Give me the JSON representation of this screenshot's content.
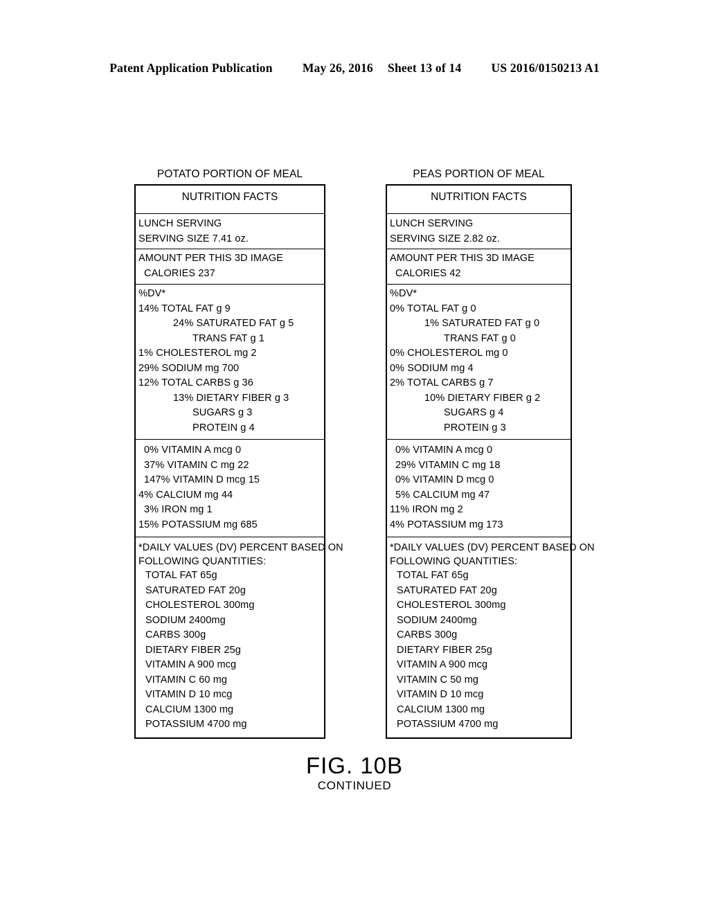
{
  "header": {
    "publication": "Patent Application Publication",
    "date": "May 26, 2016",
    "sheet": "Sheet 13 of 14",
    "docnum": "US 2016/0150213 A1"
  },
  "caption": {
    "label": "FIG. 10B",
    "sublabel": "CONTINUED"
  },
  "panels": [
    {
      "title": "POTATO PORTION OF MEAL",
      "facts_heading": "NUTRITION FACTS",
      "serving": {
        "meal": "LUNCH SERVING",
        "size": "SERVING SIZE 7.41 oz."
      },
      "amount": {
        "per": "AMOUNT PER THIS 3D IMAGE",
        "calories": "CALORIES 237"
      },
      "dv_header": "%DV*",
      "macros": [
        {
          "text": "14% TOTAL FAT g 9",
          "indent": 0
        },
        {
          "text": "24% SATURATED FAT g 5",
          "indent": 1
        },
        {
          "text": "TRANS FAT g 1",
          "indent": 2
        },
        {
          "text": "1% CHOLESTEROL mg 2",
          "indent": 0
        },
        {
          "text": "29% SODIUM mg 700",
          "indent": 0
        },
        {
          "text": "12% TOTAL CARBS g 36",
          "indent": 0
        },
        {
          "text": "13% DIETARY FIBER g 3",
          "indent": 1
        },
        {
          "text": "SUGARS g 3",
          "indent": 2
        },
        {
          "text": "PROTEIN g 4",
          "indent": 2
        }
      ],
      "micros": [
        "0% VITAMIN A mcg 0",
        "37% VITAMIN C mg 22",
        "147% VITAMIN D mcg 15",
        "4% CALCIUM mg 44",
        "3% IRON mg 1",
        "15% POTASSIUM mg 685"
      ],
      "dv_note_line1": "*DAILY VALUES (DV) PERCENT BASED ON",
      "dv_note_line2": "FOLLOWING QUANTITIES:",
      "dv_values": [
        "TOTAL FAT 65g",
        "SATURATED FAT 20g",
        "CHOLESTEROL 300mg",
        "SODIUM 2400mg",
        "CARBS 300g",
        "DIETARY FIBER 25g",
        "VITAMIN A 900 mcg",
        "VITAMIN C 60 mg",
        "VITAMIN D 10 mcg",
        "CALCIUM 1300 mg",
        "POTASSIUM 4700 mg"
      ]
    },
    {
      "title": "PEAS PORTION OF MEAL",
      "facts_heading": "NUTRITION FACTS",
      "serving": {
        "meal": "LUNCH SERVING",
        "size": "SERVING SIZE 2.82 oz."
      },
      "amount": {
        "per": "AMOUNT PER THIS 3D IMAGE",
        "calories": "CALORIES 42"
      },
      "dv_header": "%DV*",
      "macros": [
        {
          "text": "0% TOTAL FAT g 0",
          "indent": 0
        },
        {
          "text": "1% SATURATED FAT g 0",
          "indent": 1
        },
        {
          "text": "TRANS FAT g 0",
          "indent": 2
        },
        {
          "text": "0% CHOLESTEROL mg 0",
          "indent": 0
        },
        {
          "text": "0% SODIUM mg 4",
          "indent": 0
        },
        {
          "text": "2% TOTAL CARBS g 7",
          "indent": 0
        },
        {
          "text": "10% DIETARY FIBER g 2",
          "indent": 1
        },
        {
          "text": "SUGARS g 4",
          "indent": 2
        },
        {
          "text": "PROTEIN g 3",
          "indent": 2
        }
      ],
      "micros": [
        "0% VITAMIN A mcg 0",
        "29% VITAMIN C mg 18",
        "0% VITAMIN D mcg 0",
        "5% CALCIUM mg 47",
        "11% IRON mg 2",
        "4% POTASSIUM mg 173"
      ],
      "dv_note_line1": "*DAILY VALUES (DV) PERCENT BASED ON",
      "dv_note_line2": "FOLLOWING QUANTITIES:",
      "dv_values": [
        "TOTAL FAT 65g",
        "SATURATED FAT 20g",
        "CHOLESTEROL 300mg",
        "SODIUM 2400mg",
        "CARBS 300g",
        "DIETARY FIBER 25g",
        "VITAMIN A 900 mcg",
        "VITAMIN C 50 mg",
        "VITAMIN D 10 mcg",
        "CALCIUM 1300 mg",
        "POTASSIUM 4700 mg"
      ]
    }
  ]
}
